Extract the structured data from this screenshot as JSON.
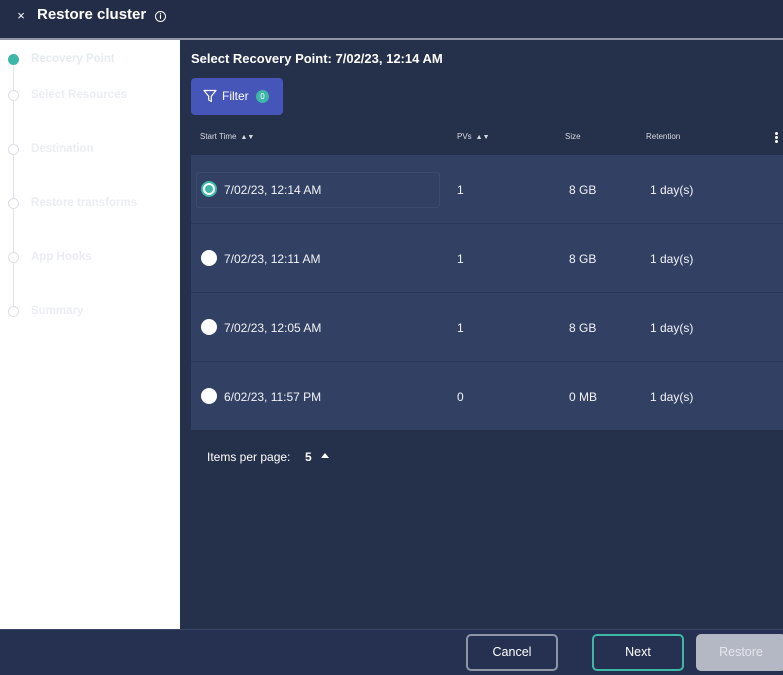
{
  "header": {
    "close_glyph": "×",
    "title": "Restore cluster",
    "info_glyph": "i"
  },
  "steps": [
    {
      "label": "Recovery Point",
      "active": true
    },
    {
      "label": "Select Resources",
      "active": false
    },
    {
      "label": "Destination",
      "active": false
    },
    {
      "label": "Restore transforms",
      "active": false
    },
    {
      "label": "App Hooks",
      "active": false
    },
    {
      "label": "Summary",
      "active": false
    }
  ],
  "content": {
    "title": "Select Recovery Point: 7/02/23, 12:14 AM",
    "filter_label": "Filter",
    "filter_count": "0"
  },
  "table": {
    "headers": {
      "start_time": "Start Time",
      "pvs": "PVs",
      "size": "Size",
      "retention": "Retention"
    },
    "sort_glyph": "▲▼",
    "rows": [
      {
        "start_time": "7/02/23, 12:14 AM",
        "pvs": "1",
        "size": "8 GB",
        "retention": "1 day(s)",
        "selected": true
      },
      {
        "start_time": "7/02/23, 12:11 AM",
        "pvs": "1",
        "size": "8 GB",
        "retention": "1 day(s)",
        "selected": false
      },
      {
        "start_time": "7/02/23, 12:05 AM",
        "pvs": "1",
        "size": "8 GB",
        "retention": "1 day(s)",
        "selected": false
      },
      {
        "start_time": "6/02/23, 11:57 PM",
        "pvs": "0",
        "size": "0 MB",
        "retention": "1 day(s)",
        "selected": false
      }
    ]
  },
  "pagination": {
    "label": "Items per page:",
    "value": "5"
  },
  "footer": {
    "cancel_label": "Cancel",
    "next_label": "Next",
    "restore_label": "Restore"
  },
  "colors": {
    "accent": "#3fb7a8",
    "filter_bg": "#4656b8",
    "panel_bg": "#25304a",
    "row_bg": "#324063"
  }
}
